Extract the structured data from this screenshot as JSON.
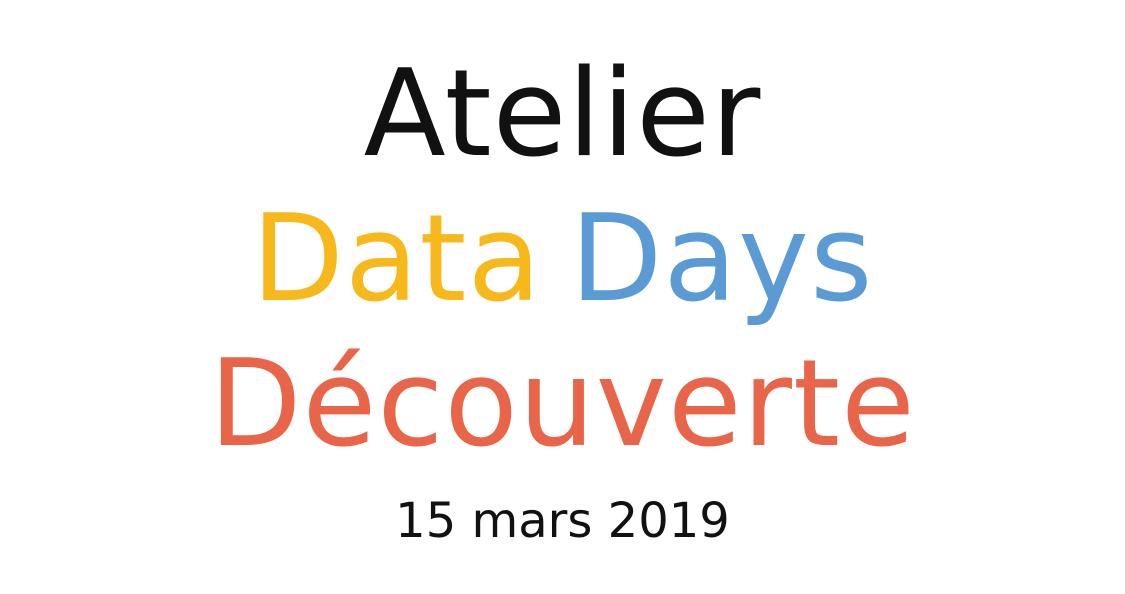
{
  "title": {
    "line1": "Atelier",
    "line2_word1": "Data",
    "line2_word2": "Days",
    "line3": "Découverte"
  },
  "date": "15 mars 2019",
  "colors": {
    "text_dark": "#111111",
    "data_yellow": "#F6B81B",
    "days_blue": "#5B9BD5",
    "decouverte_orange": "#E8654A",
    "background": "#ffffff"
  }
}
